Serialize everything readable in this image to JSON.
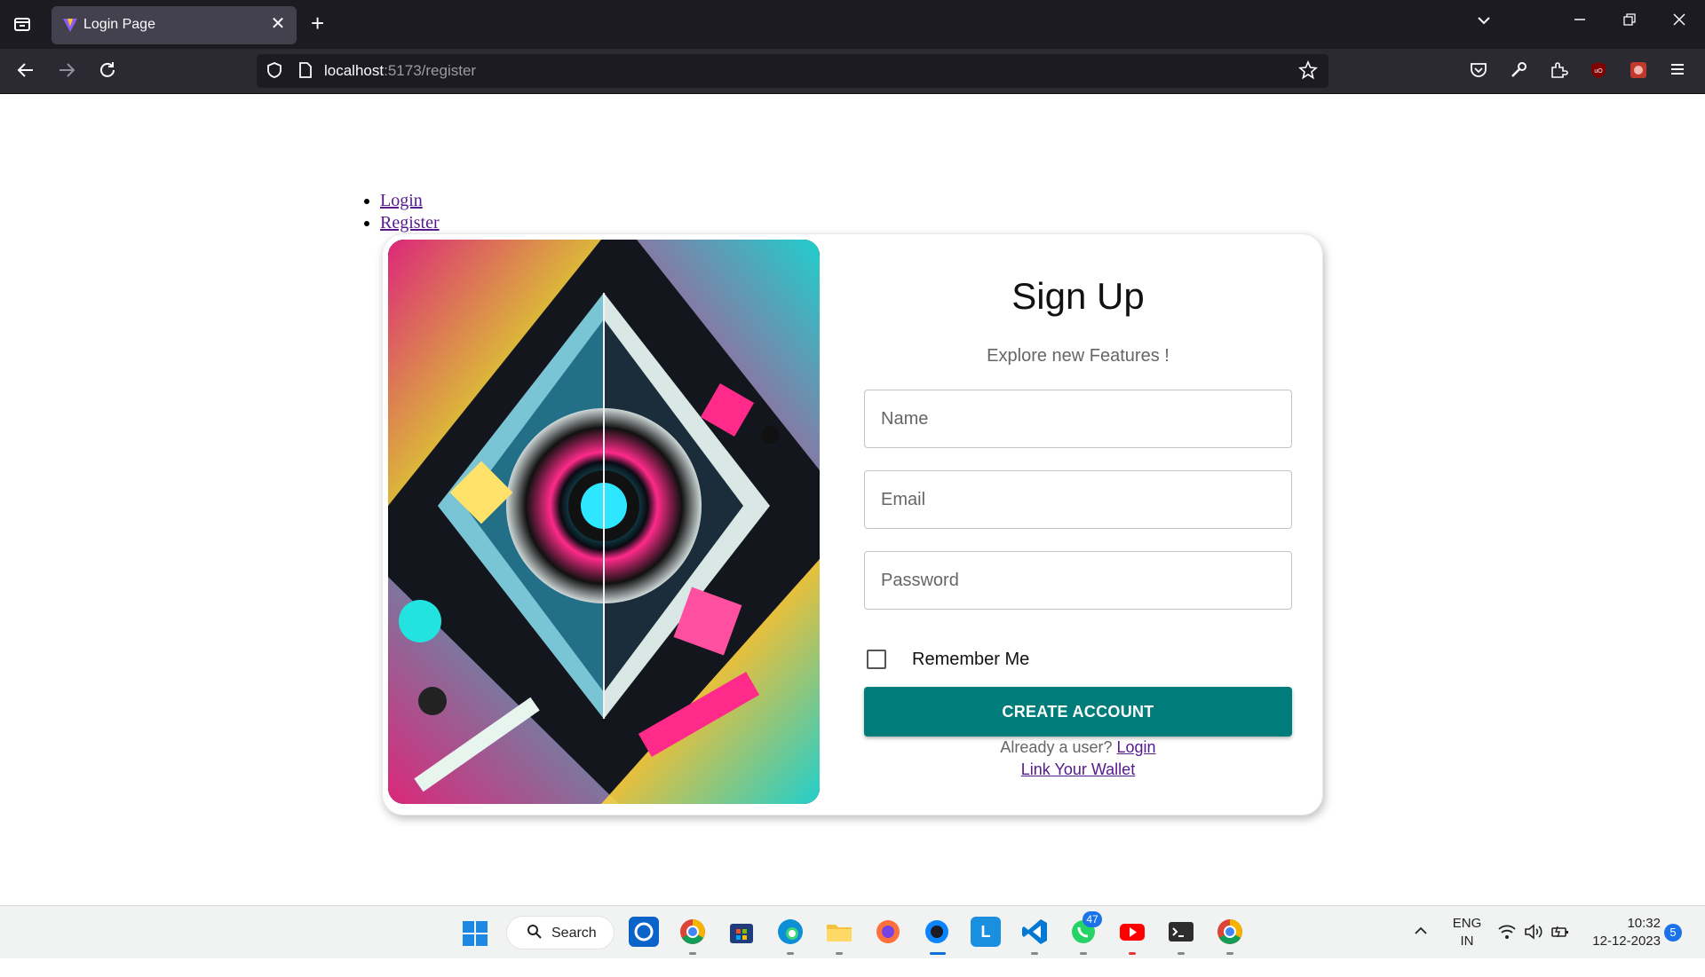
{
  "browser": {
    "tab_title": "Login Page",
    "url_host": "localhost",
    "url_rest": ":5173/register",
    "new_tab_symbol": "+",
    "close_symbol": "✕"
  },
  "page": {
    "nav_links": [
      "Login",
      "Register"
    ],
    "signup": {
      "title": "Sign Up",
      "subtitle": "Explore new Features !",
      "name_placeholder": "Name",
      "email_placeholder": "Email",
      "password_placeholder": "Password",
      "remember_label": "Remember Me",
      "create_button": "CREATE ACCOUNT",
      "already_text": "Already a user?",
      "login_link": "Login",
      "wallet_link": "Link Your Wallet"
    }
  },
  "taskbar": {
    "search_label": "Search",
    "whatsapp_badge": "47",
    "lang_line1": "ENG",
    "lang_line2": "IN",
    "time": "10:32",
    "date": "12-12-2023",
    "notification_count": "5"
  },
  "colors": {
    "accent_button": "#007c7a",
    "link": "#551a8b",
    "chrome_dark": "#1c1b22"
  }
}
